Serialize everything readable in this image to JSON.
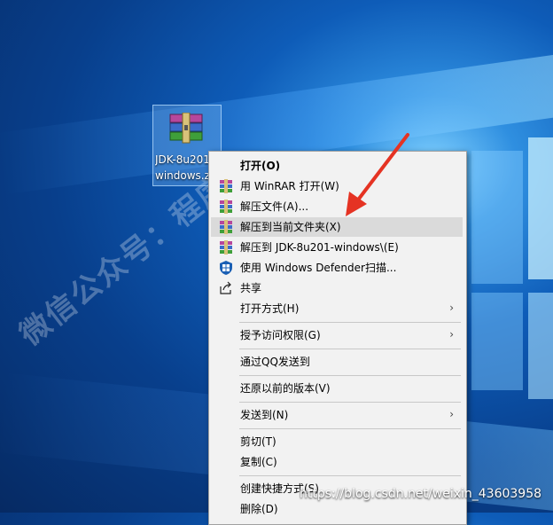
{
  "desktop_icon": {
    "line1": "JDK-8u201",
    "line2": "windows.z"
  },
  "watermark": "微信公众号：程序源",
  "menu": {
    "items": [
      {
        "label": "打开(O)"
      },
      {
        "label": "用 WinRAR 打开(W)"
      },
      {
        "label": "解压文件(A)..."
      },
      {
        "label": "解压到当前文件夹(X)"
      },
      {
        "label": "解压到 JDK-8u201-windows\\(E)"
      },
      {
        "label": "使用 Windows Defender扫描..."
      },
      {
        "label": "共享"
      },
      {
        "label": "打开方式(H)"
      },
      {
        "label": "授予访问权限(G)"
      },
      {
        "label": "通过QQ发送到"
      },
      {
        "label": "还原以前的版本(V)"
      },
      {
        "label": "发送到(N)"
      },
      {
        "label": "剪切(T)"
      },
      {
        "label": "复制(C)"
      },
      {
        "label": "创建快捷方式(S)"
      },
      {
        "label": "删除(D)"
      }
    ],
    "submenu_arrow": "›"
  },
  "icons": {
    "rar": "winrar-archive-icon",
    "defender": "windows-defender-shield-icon",
    "share": "share-icon",
    "arrow": "red-arrow-annotation"
  },
  "url_text": "https://blog.csdn.net/weixin_43603958",
  "colors": {
    "menu_bg": "#f2f2f2",
    "highlight": "#dadada",
    "annotation": "#e53323"
  }
}
